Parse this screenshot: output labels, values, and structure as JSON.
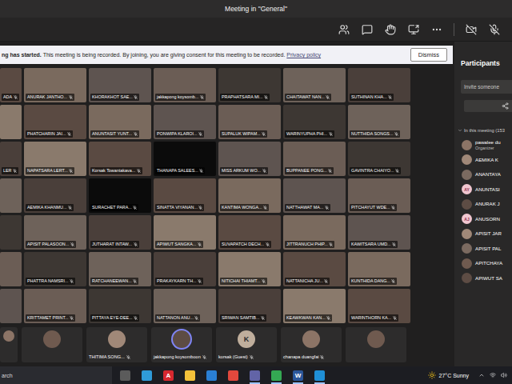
{
  "window": {
    "title": "Meeting in \"General\""
  },
  "controls": {
    "camera_on": false,
    "mic_on": false
  },
  "banner": {
    "lead": "ng has started.",
    "text": "This meeting is being recorded. By joining, you are giving consent for this meeting to be recorded.",
    "link": "Privacy policy",
    "button": "Dismiss"
  },
  "grid": [
    [
      {
        "name": "ADA",
        "camera": true,
        "partial": true
      },
      {
        "name": "ANURAK JANTHO...",
        "camera": true,
        "partial": false
      },
      {
        "name": "KHORAKHOT SAE...",
        "camera": true,
        "partial": false
      },
      {
        "name": "jakkapong koysomb...",
        "camera": true,
        "partial": false
      },
      {
        "name": "PRAPHATSARA MI...",
        "camera": true,
        "partial": false
      },
      {
        "name": "CHAITAWAT NAN...",
        "camera": true,
        "partial": false
      },
      {
        "name": "SUTHINAN KHA...",
        "camera": true,
        "partial": false
      }
    ],
    [
      {
        "name": "",
        "camera": true,
        "partial": true
      },
      {
        "name": "PHATCHARIN JAI...",
        "camera": true,
        "partial": false
      },
      {
        "name": "ANUNTASIT YUNT...",
        "camera": true,
        "partial": false
      },
      {
        "name": "PONWIPA KLAROI...",
        "camera": true,
        "partial": false
      },
      {
        "name": "SUPALUK WIPAM...",
        "camera": true,
        "partial": false
      },
      {
        "name": "WARINYUPHA PHI...",
        "camera": true,
        "partial": false
      },
      {
        "name": "NUTTHIDA SONGS...",
        "camera": true,
        "partial": false
      }
    ],
    [
      {
        "name": "LER",
        "camera": true,
        "partial": true
      },
      {
        "name": "NAPATSARA LERT...",
        "camera": true,
        "partial": false
      },
      {
        "name": "Korsak Towantakava...",
        "camera": true,
        "partial": false
      },
      {
        "name": "THANAPA SALEES...",
        "camera": false,
        "partial": false
      },
      {
        "name": "MISS ARKUM WO...",
        "camera": true,
        "partial": false
      },
      {
        "name": "BUPPANEE PONG...",
        "camera": true,
        "partial": false
      },
      {
        "name": "GAVINTRA CHAIYO...",
        "camera": true,
        "partial": false
      }
    ],
    [
      {
        "name": "",
        "camera": true,
        "partial": true
      },
      {
        "name": "AEMIKA KHANMU...",
        "camera": true,
        "partial": false
      },
      {
        "name": "SURACHET PARA...",
        "camera": false,
        "partial": false
      },
      {
        "name": "SINATTA VIYANAN...",
        "camera": true,
        "partial": false
      },
      {
        "name": "KANTIMA WONGA...",
        "camera": true,
        "partial": false
      },
      {
        "name": "NATTHAWAT MA...",
        "camera": true,
        "partial": false
      },
      {
        "name": "PITCHAYUT WDE...",
        "camera": true,
        "partial": false
      }
    ],
    [
      {
        "name": "",
        "camera": true,
        "partial": true
      },
      {
        "name": "APISIT PALASOON...",
        "camera": true,
        "partial": false
      },
      {
        "name": "JUTHARAT INTAW...",
        "camera": true,
        "partial": false
      },
      {
        "name": "APIWUT SANGKA...",
        "camera": true,
        "partial": false
      },
      {
        "name": "SUVAPATCH DECH...",
        "camera": true,
        "partial": false
      },
      {
        "name": "JITTRANUCH PHIP...",
        "camera": true,
        "partial": false
      },
      {
        "name": "KAWITSARA UMD...",
        "camera": true,
        "partial": false
      }
    ],
    [
      {
        "name": "",
        "camera": true,
        "partial": true
      },
      {
        "name": "PHATTRA NAMSRI...",
        "camera": true,
        "partial": false
      },
      {
        "name": "RATCHANEEWAN...",
        "camera": true,
        "partial": false
      },
      {
        "name": "PRAKAYKARN TH...",
        "camera": true,
        "partial": false
      },
      {
        "name": "NITICHAI THIAMT...",
        "camera": true,
        "partial": false
      },
      {
        "name": "NATTANICHA JU...",
        "camera": true,
        "partial": false
      },
      {
        "name": "KUNTHIDA DANG...",
        "camera": true,
        "partial": false
      }
    ],
    [
      {
        "name": "",
        "camera": true,
        "partial": true
      },
      {
        "name": "KRITTAMET PRINT...",
        "camera": true,
        "partial": false
      },
      {
        "name": "PITTAYA EYE-DEE...",
        "camera": true,
        "partial": false
      },
      {
        "name": "NATTANON ANU...",
        "camera": true,
        "partial": false
      },
      {
        "name": "SRIWAN SAMTIB...",
        "camera": true,
        "partial": false
      },
      {
        "name": "KEAWKWAN KAN...",
        "camera": true,
        "partial": false
      },
      {
        "name": "WARINTHORN KA...",
        "camera": true,
        "partial": false
      }
    ]
  ],
  "strip": [
    {
      "name": "",
      "initials": "",
      "speaking": false,
      "partial": true
    },
    {
      "name": "",
      "initials": "",
      "speaking": false,
      "partial": false
    },
    {
      "name": "THITIMA SONG...",
      "initials": "",
      "speaking": false,
      "partial": false
    },
    {
      "name": "jakkapong koysomboon",
      "initials": "",
      "speaking": true,
      "partial": false
    },
    {
      "name": "korsak (Guest)",
      "initials": "K",
      "speaking": false,
      "partial": false
    },
    {
      "name": "chanapa duangfai",
      "initials": "",
      "speaking": false,
      "partial": false
    },
    {
      "name": "",
      "initials": "",
      "speaking": false,
      "partial": false
    }
  ],
  "participants": {
    "title": "Participants",
    "invite_placeholder": "Invite someone",
    "section": "In this meeting (153",
    "expanded": true,
    "people": [
      {
        "name": "pawalee du",
        "role": "Organizer",
        "initials": ""
      },
      {
        "name": "AEMIKA K",
        "role": "",
        "initials": ""
      },
      {
        "name": "ANANTAYA",
        "role": "",
        "initials": ""
      },
      {
        "name": "ANUNTASI",
        "role": "",
        "initials": "AY"
      },
      {
        "name": "ANURAK J",
        "role": "",
        "initials": ""
      },
      {
        "name": "ANUSORN",
        "role": "",
        "initials": "AJ"
      },
      {
        "name": "APISIT JAR",
        "role": "",
        "initials": ""
      },
      {
        "name": "APISIT PAL",
        "role": "",
        "initials": ""
      },
      {
        "name": "APITCHAYA",
        "role": "",
        "initials": ""
      },
      {
        "name": "APIWUT SA",
        "role": "",
        "initials": ""
      }
    ]
  },
  "taskbar": {
    "search": "arch",
    "apps": [
      {
        "glyph": "",
        "color": "#5b5b5b",
        "open": false
      },
      {
        "glyph": "",
        "color": "#2f9bd8",
        "open": false
      },
      {
        "glyph": "A",
        "color": "#d7282f",
        "open": false
      },
      {
        "glyph": "",
        "color": "#f3c13a",
        "open": false
      },
      {
        "glyph": "",
        "color": "#2a7fd4",
        "open": false
      },
      {
        "glyph": "",
        "color": "#e2483d",
        "open": false
      },
      {
        "glyph": "",
        "color": "#6264a7",
        "open": true
      },
      {
        "glyph": "",
        "color": "#34a853",
        "open": true
      },
      {
        "glyph": "W",
        "color": "#2b579a",
        "open": true
      },
      {
        "glyph": "",
        "color": "#1f8fd6",
        "open": true
      }
    ],
    "weather": "27°C Sunny"
  }
}
